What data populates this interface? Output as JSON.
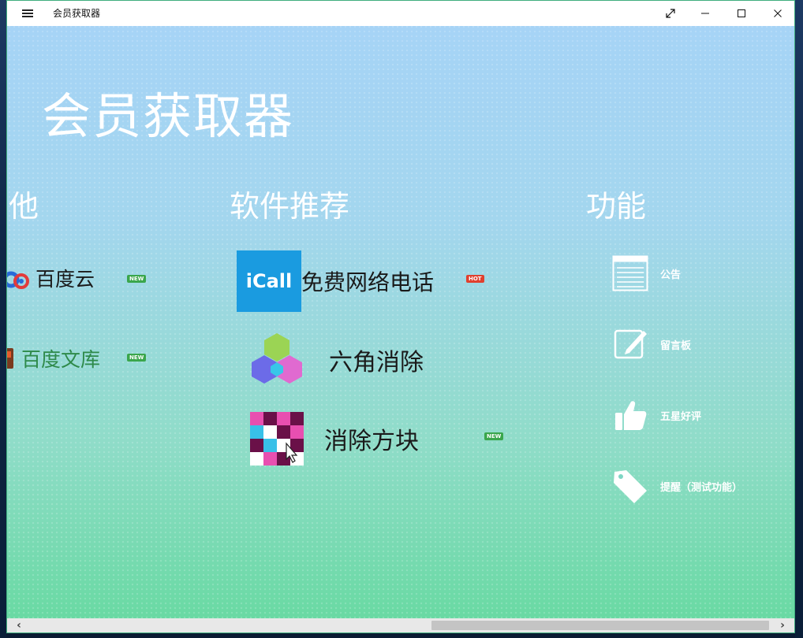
{
  "titlebar": {
    "title": "会员获取器",
    "fullscreen_icon": "expand-diagonal-icon",
    "minimize_icon": "minimize-icon",
    "maximize_icon": "maximize-icon",
    "close_icon": "close-icon"
  },
  "page": {
    "title": "会员获取器"
  },
  "sections": {
    "other": {
      "title": "其他",
      "items": [
        {
          "label": "百度云",
          "badge": "NEW",
          "icon": "baidu-cloud-logo"
        },
        {
          "label": "百度文库",
          "badge": "NEW",
          "icon": "baidu-wenku-logo"
        }
      ]
    },
    "recommend": {
      "title": "软件推荐",
      "items": [
        {
          "logo_text": "iCall",
          "label": "免费网络电话",
          "badge": "HOT",
          "icon": "icall-logo"
        },
        {
          "label": "六角消除",
          "badge": "",
          "icon": "hexagon-game-icon"
        },
        {
          "label": "消除方块",
          "badge": "NEW",
          "icon": "block-game-icon"
        }
      ]
    },
    "functions": {
      "title": "功能",
      "items": [
        {
          "label": "公告",
          "icon": "notice-board-icon"
        },
        {
          "label": "留言板",
          "icon": "note-pencil-icon"
        },
        {
          "label": "五星好评",
          "icon": "thumbs-up-icon"
        },
        {
          "label": "提醒（测试功能）",
          "icon": "tag-icon"
        }
      ]
    }
  },
  "colors": {
    "background_top": "#a6d3f7",
    "background_bottom": "#66d9a0",
    "new_badge": "#3aa64c",
    "hot_badge": "#e0402e",
    "icall_blue": "#1a9be0",
    "window_border": "#3fae7e"
  },
  "scrollbar": {
    "left_arrow": "‹",
    "right_arrow": "›"
  }
}
